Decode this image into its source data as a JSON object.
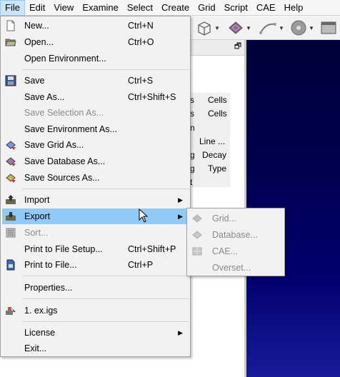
{
  "menubar": [
    "File",
    "Edit",
    "View",
    "Examine",
    "Select",
    "Create",
    "Grid",
    "Script",
    "CAE",
    "Help"
  ],
  "panel": {
    "cells": [
      "s",
      "Cells",
      "s",
      "Cells",
      "n",
      "Line ...",
      "g",
      "Decay",
      "g",
      "Type",
      "t"
    ]
  },
  "file_menu": {
    "new": {
      "label": "New...",
      "shortcut": "Ctrl+N"
    },
    "open": {
      "label": "Open...",
      "shortcut": "Ctrl+O"
    },
    "open_env": {
      "label": "Open Environment..."
    },
    "save": {
      "label": "Save",
      "shortcut": "Ctrl+S"
    },
    "save_as": {
      "label": "Save As...",
      "shortcut": "Ctrl+Shift+S"
    },
    "save_selection": {
      "label": "Save Selection As..."
    },
    "save_env": {
      "label": "Save Environment As..."
    },
    "save_grid": {
      "label": "Save Grid As..."
    },
    "save_db": {
      "label": "Save Database As..."
    },
    "save_sources": {
      "label": "Save Sources As..."
    },
    "import": {
      "label": "Import"
    },
    "export": {
      "label": "Export"
    },
    "sort": {
      "label": "Sort..."
    },
    "print_setup": {
      "label": "Print to File Setup...",
      "shortcut": "Ctrl+Shift+P"
    },
    "print": {
      "label": "Print to File...",
      "shortcut": "Ctrl+P"
    },
    "properties": {
      "label": "Properties..."
    },
    "recent1": {
      "label": "1. ex.igs"
    },
    "license": {
      "label": "License"
    },
    "exit": {
      "label": "Exit..."
    }
  },
  "export_menu": [
    "Grid...",
    "Database...",
    "CAE...",
    "Overset..."
  ],
  "colors": {
    "highlight": "#91c9f7",
    "menubar_active": "#cce4f7",
    "viewport": "#00004d"
  }
}
